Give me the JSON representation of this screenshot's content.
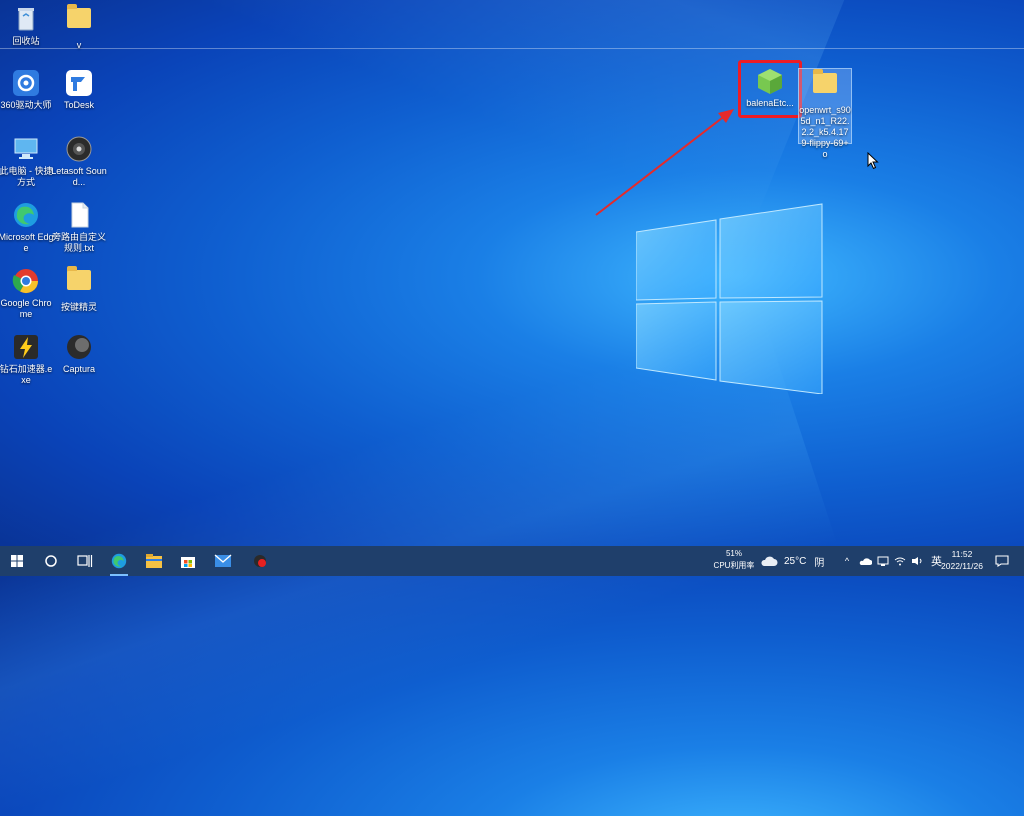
{
  "desktop": {
    "icons": [
      {
        "label": "回收站"
      },
      {
        "label": "v"
      },
      {
        "label": "360驱动大师"
      },
      {
        "label": "ToDesk"
      },
      {
        "label": "此电脑 - 快捷方式"
      },
      {
        "label": "Letasoft Sound..."
      },
      {
        "label": "Microsoft Edge"
      },
      {
        "label": "旁路由自定义规则.txt"
      },
      {
        "label": "Google Chrome"
      },
      {
        "label": "按键精灵"
      },
      {
        "label": "钻石加速器.exe"
      },
      {
        "label": "Captura"
      },
      {
        "label": "balenaEtc..."
      },
      {
        "label": "openwrt_s905d_n1_R22.2.2_k5.4.179-flippy-69+o"
      }
    ]
  },
  "taskbar": {
    "cpu_percent": "51%",
    "cpu_label": "CPU利用率",
    "weather_temp": "25°C",
    "weather_desc": "阴",
    "ime": "英",
    "time": "11:52",
    "date": "2022/11/26"
  },
  "colors": {
    "highlight": "#ee1c25",
    "taskbar": "#1f3f6b"
  }
}
